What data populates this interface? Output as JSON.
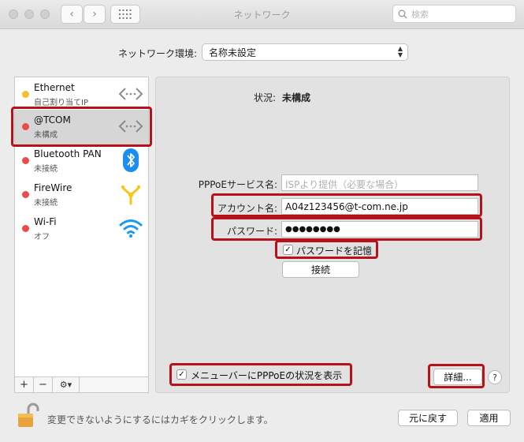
{
  "window": {
    "title": "ネットワーク"
  },
  "toolbar": {
    "back_label": "‹",
    "forward_label": "›",
    "search_placeholder": "検索"
  },
  "env": {
    "label": "ネットワーク環境:",
    "value": "名称未設定"
  },
  "services": [
    {
      "name": "Ethernet",
      "status": "自己割り当てIP",
      "dot_color": "#f6bd2e",
      "icon": "ethernet-arrows-icon"
    },
    {
      "name": "@TCOM",
      "status": "未構成",
      "dot_color": "#ea4b4b",
      "icon": "ethernet-arrows-icon"
    },
    {
      "name": "Bluetooth PAN",
      "status": "未接続",
      "dot_color": "#ea4b4b",
      "icon": "bluetooth-icon"
    },
    {
      "name": "FireWire",
      "status": "未接続",
      "dot_color": "#ea4b4b",
      "icon": "firewire-icon"
    },
    {
      "name": "Wi-Fi",
      "status": "オフ",
      "dot_color": "#ea4b4b",
      "icon": "wifi-icon"
    }
  ],
  "sidebar_buttons": {
    "add": "+",
    "remove": "−",
    "gear": "⚙▾"
  },
  "detail": {
    "status_label": "状況:",
    "status_value": "未構成",
    "pppoe_label": "PPPoEサービス名:",
    "pppoe_placeholder": "ISPより提供（必要な場合）",
    "account_label": "アカウント名:",
    "account_value": "A04z123456@t-com.ne.jp",
    "password_label": "パスワード:",
    "password_value": "●●●●●●●●",
    "remember_label": "パスワードを記憶",
    "remember_checked": "✓",
    "connect_label": "接続",
    "menubar_label": "メニューバーにPPPoEの状況を表示",
    "menubar_checked": "✓",
    "advanced_label": "詳細...",
    "help_label": "?"
  },
  "footer": {
    "lock_message": "変更できないようにするにはカギをクリックします。",
    "revert_label": "元に戻す",
    "apply_label": "適用"
  },
  "colors": {
    "highlight": "#b5121b",
    "selected_row": "#d6d6d6",
    "wifi_blue": "#1a9bf0",
    "firewire_yellow": "#f5c518"
  }
}
